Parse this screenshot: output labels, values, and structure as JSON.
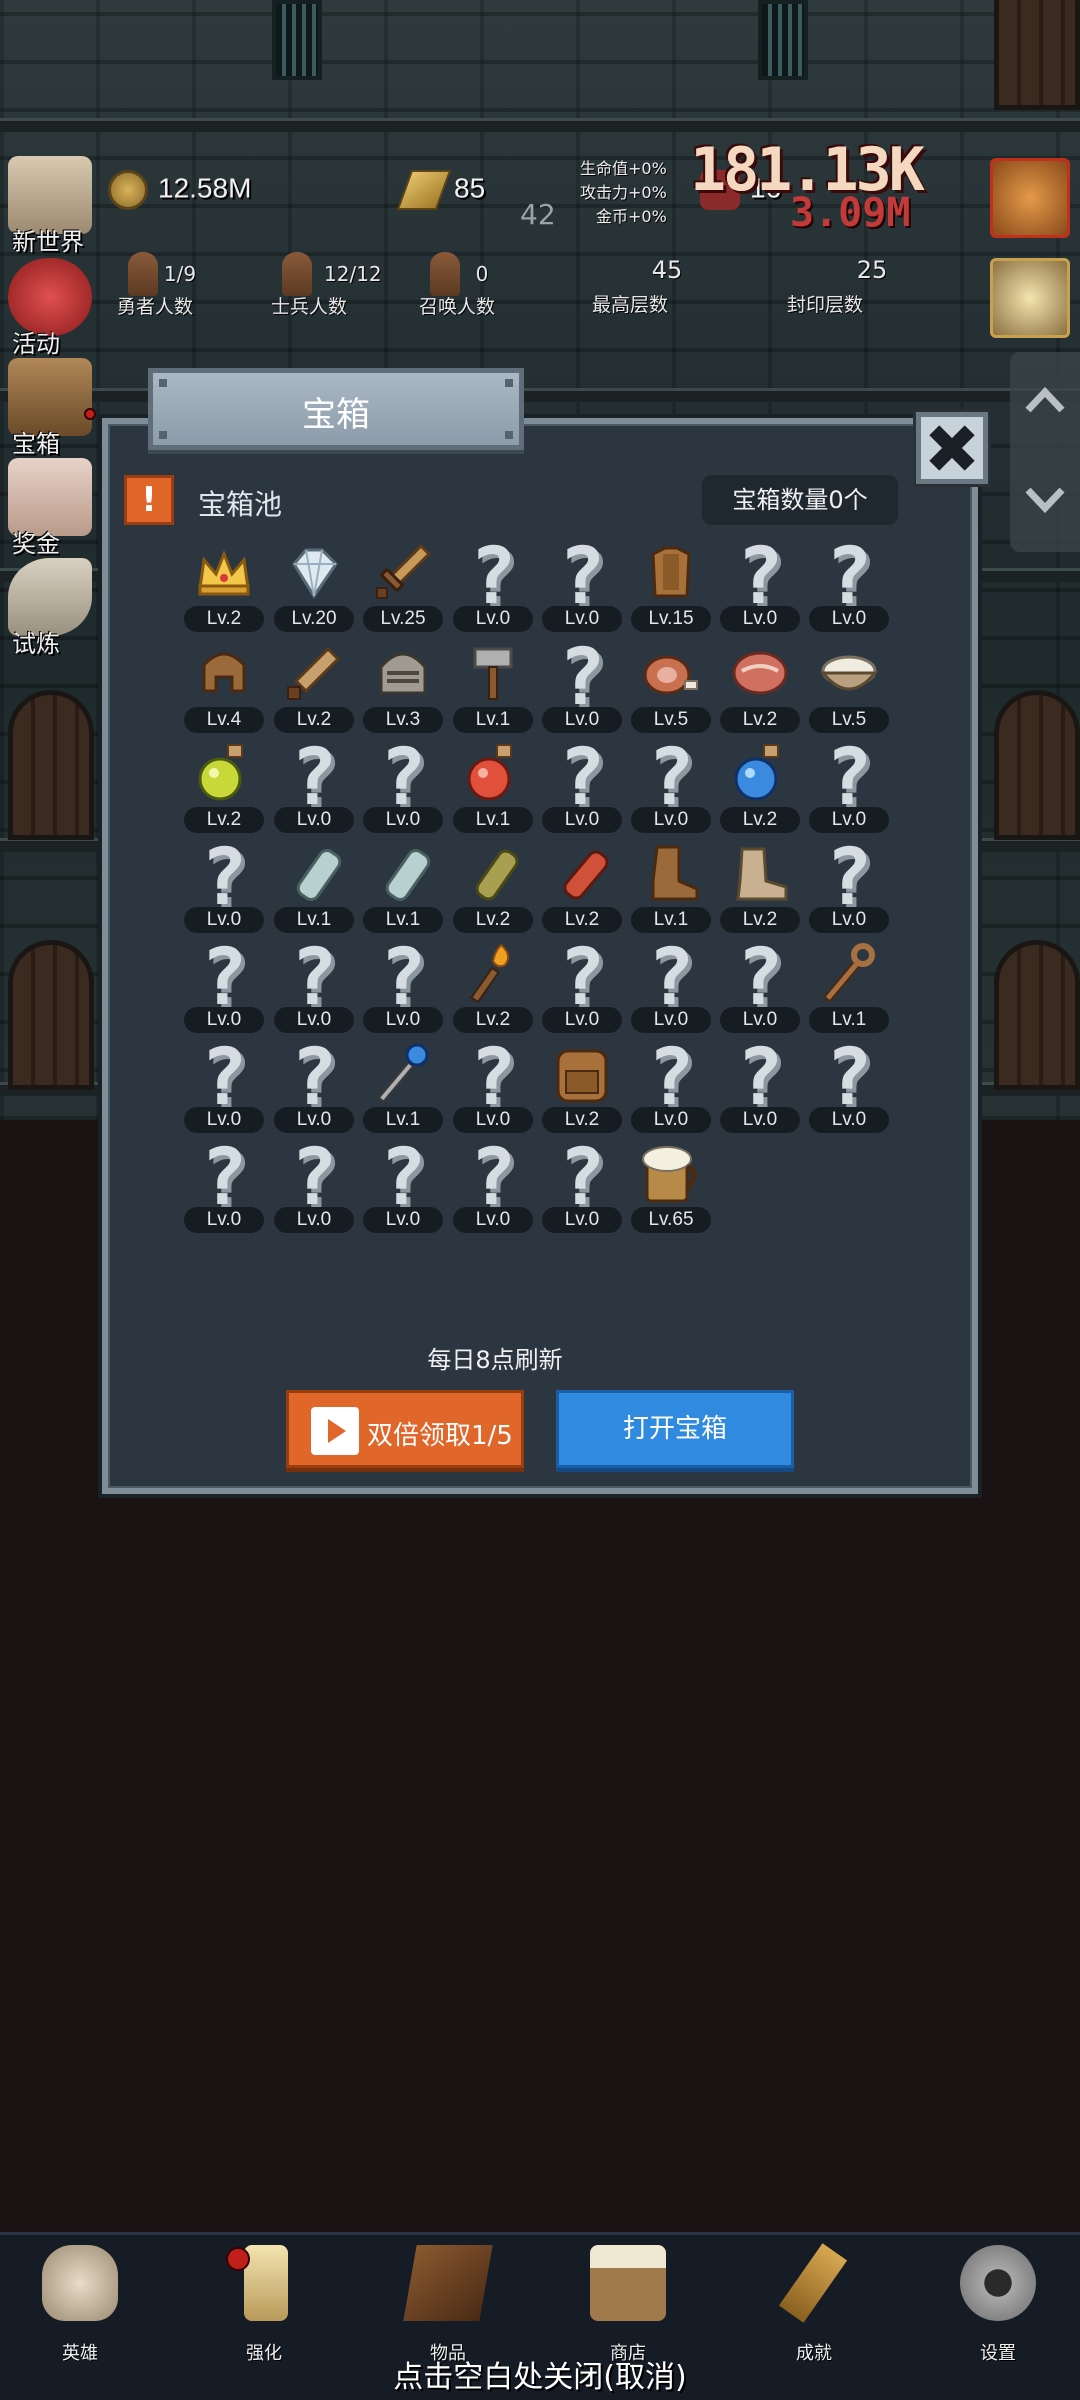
{
  "header": {
    "coins": "12.58M",
    "gold_bars": "85",
    "gems": "16",
    "floating_number": "42",
    "bonuses": [
      "生命值+0%",
      "攻击力+0%",
      "金币+0%"
    ],
    "damage_big": "181.13K",
    "damage_small": "3.09M"
  },
  "stats": [
    {
      "value": "1/9",
      "label": "勇者人数"
    },
    {
      "value": "12/12",
      "label": "士兵人数"
    },
    {
      "value": "0",
      "label": "召唤人数"
    },
    {
      "value": "45",
      "label": "最高层数"
    },
    {
      "value": "25",
      "label": "封印层数"
    }
  ],
  "side_menu": [
    "新世界",
    "活动",
    "宝箱",
    "奖金",
    "试炼"
  ],
  "modal": {
    "title": "宝箱",
    "pool_label": "宝箱池",
    "chest_count": "宝箱数量0个",
    "refresh_note": "每日8点刷新",
    "double_button": "双倍领取1/5",
    "open_button": "打开宝箱"
  },
  "items": [
    {
      "icon": "crown-icon",
      "level": "Lv.2"
    },
    {
      "icon": "diamond-icon",
      "level": "Lv.20"
    },
    {
      "icon": "sword-icon",
      "level": "Lv.25"
    },
    {
      "icon": "unknown-icon",
      "level": "Lv.0"
    },
    {
      "icon": "unknown-icon",
      "level": "Lv.0"
    },
    {
      "icon": "leather-armor-icon",
      "level": "Lv.15"
    },
    {
      "icon": "unknown-icon",
      "level": "Lv.0"
    },
    {
      "icon": "unknown-icon",
      "level": "Lv.0"
    },
    {
      "icon": "leather-helmet-icon",
      "level": "Lv.4"
    },
    {
      "icon": "short-sword-icon",
      "level": "Lv.2"
    },
    {
      "icon": "iron-helmet-icon",
      "level": "Lv.3"
    },
    {
      "icon": "hammer-icon",
      "level": "Lv.1"
    },
    {
      "icon": "unknown-icon",
      "level": "Lv.0"
    },
    {
      "icon": "ham-icon",
      "level": "Lv.5"
    },
    {
      "icon": "steak-icon",
      "level": "Lv.2"
    },
    {
      "icon": "rice-bowl-icon",
      "level": "Lv.5"
    },
    {
      "icon": "yellow-potion-icon",
      "level": "Lv.2"
    },
    {
      "icon": "unknown-icon",
      "level": "Lv.0"
    },
    {
      "icon": "unknown-icon",
      "level": "Lv.0"
    },
    {
      "icon": "red-potion-icon",
      "level": "Lv.1"
    },
    {
      "icon": "unknown-icon",
      "level": "Lv.0"
    },
    {
      "icon": "unknown-icon",
      "level": "Lv.0"
    },
    {
      "icon": "blue-potion-icon",
      "level": "Lv.2"
    },
    {
      "icon": "unknown-icon",
      "level": "Lv.0"
    },
    {
      "icon": "unknown-icon",
      "level": "Lv.0"
    },
    {
      "icon": "glass-bottle-icon",
      "level": "Lv.1"
    },
    {
      "icon": "glass-bottle-icon",
      "level": "Lv.1"
    },
    {
      "icon": "olive-bottle-icon",
      "level": "Lv.2"
    },
    {
      "icon": "red-bottle-icon",
      "level": "Lv.2"
    },
    {
      "icon": "leather-boot-icon",
      "level": "Lv.1"
    },
    {
      "icon": "cloth-boot-icon",
      "level": "Lv.2"
    },
    {
      "icon": "unknown-icon",
      "level": "Lv.0"
    },
    {
      "icon": "unknown-icon",
      "level": "Lv.0"
    },
    {
      "icon": "unknown-icon",
      "level": "Lv.0"
    },
    {
      "icon": "unknown-icon",
      "level": "Lv.0"
    },
    {
      "icon": "torch-icon",
      "level": "Lv.2"
    },
    {
      "icon": "unknown-icon",
      "level": "Lv.0"
    },
    {
      "icon": "unknown-icon",
      "level": "Lv.0"
    },
    {
      "icon": "unknown-icon",
      "level": "Lv.0"
    },
    {
      "icon": "wooden-staff-icon",
      "level": "Lv.1"
    },
    {
      "icon": "unknown-icon",
      "level": "Lv.0"
    },
    {
      "icon": "unknown-icon",
      "level": "Lv.0"
    },
    {
      "icon": "magic-wand-icon",
      "level": "Lv.1"
    },
    {
      "icon": "unknown-icon",
      "level": "Lv.0"
    },
    {
      "icon": "backpack-icon",
      "level": "Lv.2"
    },
    {
      "icon": "unknown-icon",
      "level": "Lv.0"
    },
    {
      "icon": "unknown-icon",
      "level": "Lv.0"
    },
    {
      "icon": "unknown-icon",
      "level": "Lv.0"
    },
    {
      "icon": "unknown-icon",
      "level": "Lv.0"
    },
    {
      "icon": "unknown-icon",
      "level": "Lv.0"
    },
    {
      "icon": "unknown-icon",
      "level": "Lv.0"
    },
    {
      "icon": "unknown-icon",
      "level": "Lv.0"
    },
    {
      "icon": "unknown-icon",
      "level": "Lv.0"
    },
    {
      "icon": "beer-mug-icon",
      "level": "Lv.65"
    }
  ],
  "bottom_nav": [
    "英雄",
    "强化",
    "物品",
    "商店",
    "成就",
    "设置"
  ],
  "close_hint": "点击空白处关闭(取消)",
  "colors": {
    "modal_bg": "#2b3640",
    "accent_orange": "#e0662a",
    "accent_blue": "#2f8ae0"
  }
}
